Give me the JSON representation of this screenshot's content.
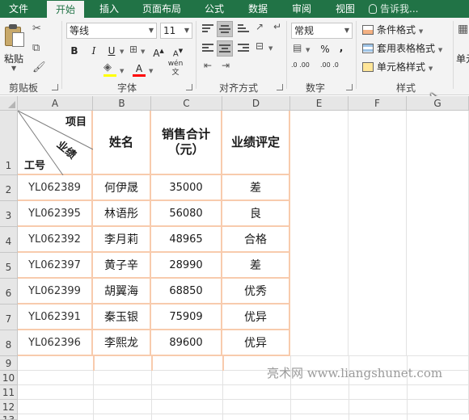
{
  "tabs": [
    "文件",
    "开始",
    "插入",
    "页面布局",
    "公式",
    "数据",
    "审阅",
    "视图"
  ],
  "active_tab": "开始",
  "tell_me": "告诉我...",
  "ribbon": {
    "clipboard": {
      "paste_label": "粘贴",
      "group_label": "剪贴板"
    },
    "font": {
      "name": "等线",
      "size": "11",
      "group_label": "字体",
      "bold": "B",
      "italic": "I",
      "underline": "U",
      "grow": "A",
      "shrink": "A",
      "font_color": "A",
      "phonetic": "wén 文"
    },
    "alignment": {
      "group_label": "对齐方式"
    },
    "number": {
      "format": "常规",
      "percent": "%",
      "comma": ",",
      "inc_decimal": ".0 .00",
      "dec_decimal": ".00 .0",
      "group_label": "数字"
    },
    "styles": {
      "conditional": "条件格式",
      "table_format": "套用表格格式",
      "cell_styles": "单元格样式",
      "group_label": "样式"
    },
    "cells": {
      "partial_label": "单元"
    }
  },
  "columns": [
    "A",
    "B",
    "C",
    "D",
    "E",
    "F",
    "G"
  ],
  "rows": [
    "1",
    "2",
    "3",
    "4",
    "5",
    "6",
    "7",
    "8",
    "9",
    "10",
    "11",
    "12",
    "13"
  ],
  "table": {
    "diag_top": "项目",
    "diag_mid": "业绩",
    "diag_bottom": "工号",
    "headers": [
      "姓名",
      "销售合计（元）",
      "业绩评定"
    ],
    "header_c_line1": "销售合计",
    "header_c_line2": "（元）",
    "records": [
      {
        "id": "YL062389",
        "name": "何伊晟",
        "sales": "35000",
        "rating": "差"
      },
      {
        "id": "YL062395",
        "name": "林语彤",
        "sales": "56080",
        "rating": "良"
      },
      {
        "id": "YL062392",
        "name": "李月莉",
        "sales": "48965",
        "rating": "合格"
      },
      {
        "id": "YL062397",
        "name": "黄子辛",
        "sales": "28990",
        "rating": "差"
      },
      {
        "id": "YL062399",
        "name": "胡翼海",
        "sales": "68850",
        "rating": "优秀"
      },
      {
        "id": "YL062391",
        "name": "秦玉银",
        "sales": "75909",
        "rating": "优异"
      },
      {
        "id": "YL062396",
        "name": "李熙龙",
        "sales": "89600",
        "rating": "优异"
      }
    ]
  },
  "watermark": "亮术网 www.liangshunet.com",
  "colors": {
    "excel_green": "#217346",
    "table_border": "#f8cbad",
    "ribbon_bg": "#f3f3f3"
  }
}
